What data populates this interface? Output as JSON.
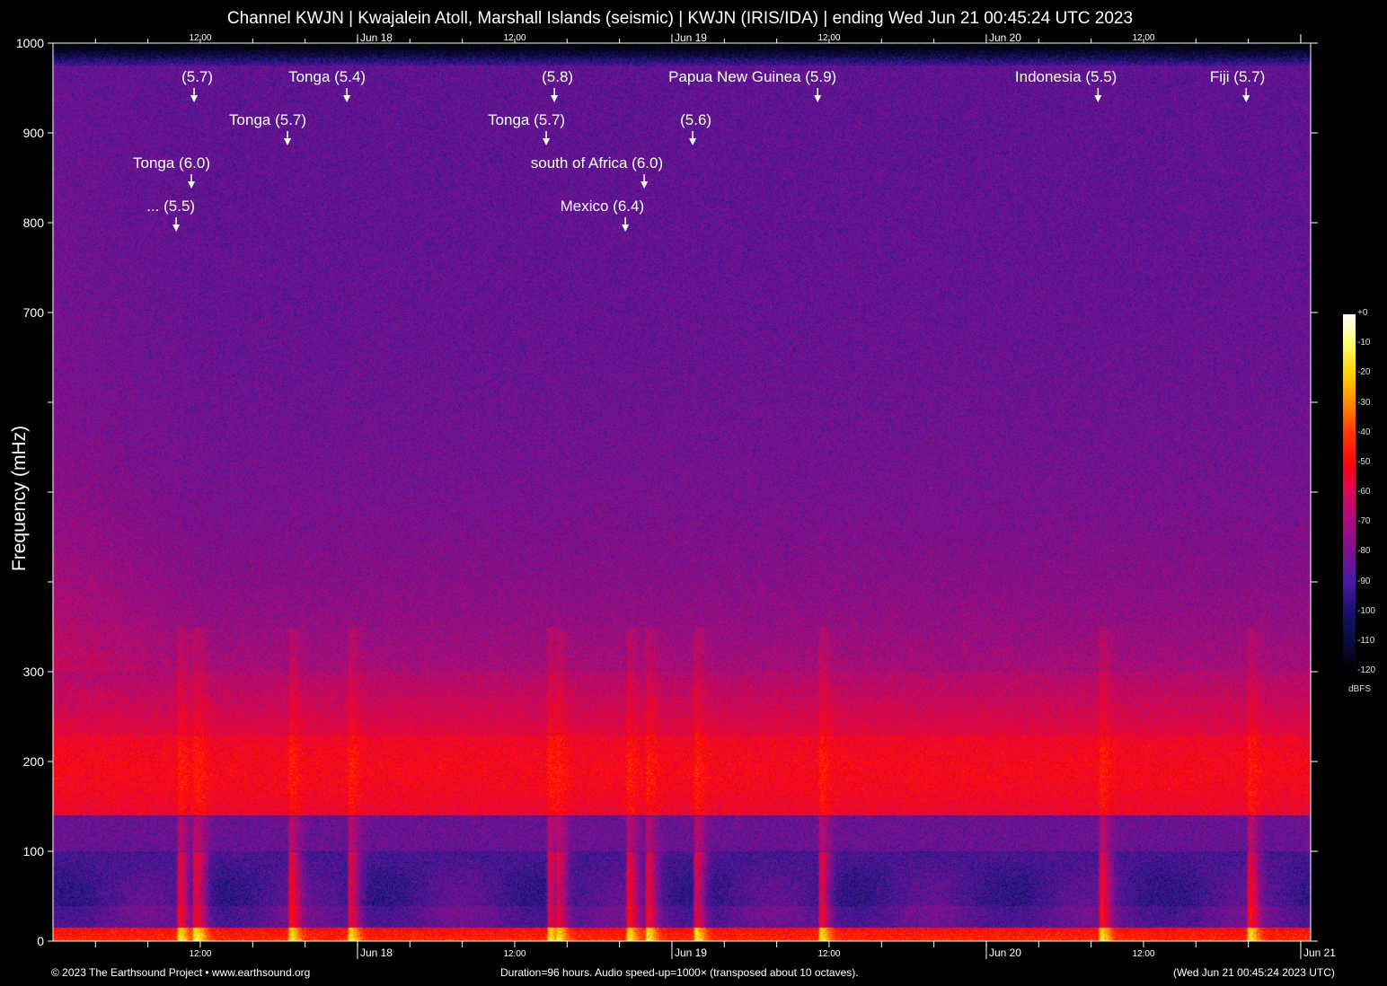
{
  "title": "Channel KWJN | Kwajalein Atoll, Marshall Islands (seismic) | KWJN (IRIS/IDA) | ending Wed Jun 21 00:45:24 UTC 2023",
  "footer": {
    "copyright": "© 2023 The Earthsound Project • www.earthsound.org",
    "duration": "Duration=96 hours. Audio speed-up=1000× (transposed about 10 octaves).",
    "timestamp": "(Wed Jun 21 00:45:24 2023 UTC)"
  },
  "chart_data": {
    "type": "heatmap",
    "title": "Channel KWJN | Kwajalein Atoll, Marshall Islands (seismic) | KWJN (IRIS/IDA) | ending Wed Jun 21 00:45:24 UTC 2023",
    "ylabel": "Frequency (mHz)",
    "xlabel": "",
    "x_range_hours": [
      0,
      96
    ],
    "ylim": [
      0,
      1000
    ],
    "y_ticks": [
      0,
      100,
      200,
      300,
      400,
      500,
      600,
      700,
      800,
      900,
      1000
    ],
    "y_tick_labels": [
      "0",
      "100",
      "200",
      "300",
      "",
      "",
      "",
      "700",
      "800",
      "900",
      "1000"
    ],
    "x_major_ticks": [
      {
        "hour": 23.243,
        "label": "Jun 18"
      },
      {
        "hour": 47.243,
        "label": "Jun 19"
      },
      {
        "hour": 71.243,
        "label": "Jun 20"
      },
      {
        "hour": 95.243,
        "label": "Jun 21"
      }
    ],
    "x_noon_ticks": [
      {
        "hour": 11.243,
        "label": "12:00"
      },
      {
        "hour": 35.243,
        "label": "12:00"
      },
      {
        "hour": 59.243,
        "label": "12:00"
      },
      {
        "hour": 83.243,
        "label": "12:00"
      }
    ],
    "colorbar": {
      "label": "dBFS",
      "ticks": [
        "+0",
        "-10",
        "-20",
        "-30",
        "-40",
        "-50",
        "-60",
        "-70",
        "-80",
        "-90",
        "-100",
        "-110",
        "-120"
      ],
      "range": [
        -120,
        0
      ]
    },
    "events": [
      {
        "label": "(5.7)",
        "hour": 10.77
      },
      {
        "label": "Tonga (5.4)",
        "hour": 22.43
      },
      {
        "label": "(5.8)",
        "hour": 38.27
      },
      {
        "label": "Papua New Guinea (5.9)",
        "hour": 58.37
      },
      {
        "label": "Indonesia (5.5)",
        "hour": 79.77
      },
      {
        "label": "Fiji (5.7)",
        "hour": 91.08
      },
      {
        "label": "Tonga (5.7)",
        "hour": 17.9
      },
      {
        "label": "Tonga (5.7)",
        "hour": 37.65
      },
      {
        "label": "(5.6)",
        "hour": 48.83
      },
      {
        "label": "Tonga (6.0)",
        "hour": 10.56
      },
      {
        "label": "south of Africa (6.0)",
        "hour": 45.13
      },
      {
        "label": "... (5.5)",
        "hour": 9.4
      },
      {
        "label": "Mexico (6.4)",
        "hour": 43.69
      }
    ]
  }
}
